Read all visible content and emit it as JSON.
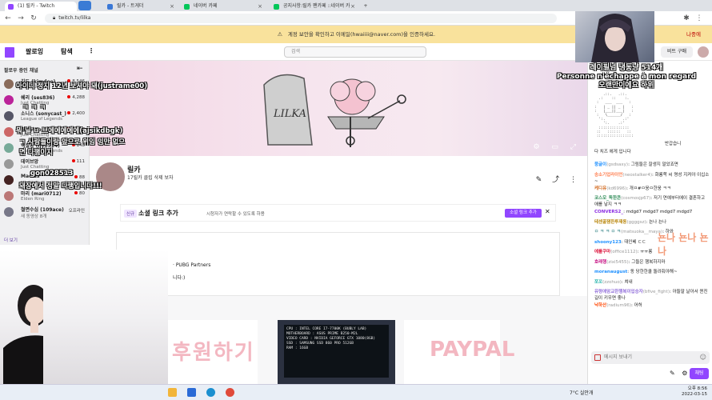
{
  "browser": {
    "tabs": [
      {
        "label": "(1) 릴카 - Twitch",
        "active": true
      },
      {
        "label": "릴카 - 트게더",
        "active": false
      },
      {
        "label": "네이버 카페",
        "active": false
      },
      {
        "label": "공지사항:릴카 팬카페 ::네이버 카",
        "active": false
      }
    ],
    "new_tab": "+",
    "url": "twitch.tv/lilka"
  },
  "banner": {
    "text": "계정 보안을 확인하고 이메일(hwaiiii@naver.com)을 인증하세요.",
    "link": "나중에"
  },
  "topnav": {
    "following": "팔로잉",
    "browse": "탐색",
    "more": "⋮",
    "search_placeholder": "검색",
    "bits_button": "비트 구매"
  },
  "sidebar": {
    "title": "팔로우 중인 채널",
    "collapse": "⇤",
    "channels": [
      {
        "name": "김도 (kimdoe)",
        "category": "Days Gone",
        "viewers": "8,546"
      },
      {
        "name": "쉐리 (ses836)",
        "category": "Just Chatting",
        "viewers": "4,288"
      },
      {
        "name": "소니스 (sonycast_)",
        "category": "League of Legends",
        "viewers": "2,400"
      },
      {
        "name": "팔세부 (p.12/45)",
        "category": "Just Chatting",
        "viewers": "1,047"
      },
      {
        "name": "백설양 (ljy0514)",
        "category": "League of Legends",
        "viewers": "148"
      },
      {
        "name": "데이브앙",
        "category": "Just Chatting",
        "viewers": "111"
      },
      {
        "name": "Macius",
        "category": "Lost Ark",
        "viewers": "88"
      },
      {
        "name": "마리 (mari0712)",
        "category": "Elden Ring",
        "viewers": "80"
      },
      {
        "name": "철면수심 (109ace)",
        "category": "새 동영상 8개",
        "viewers": "오프라인"
      }
    ],
    "show_more": "더 보기"
  },
  "stream_overlay_subtitles": [
    {
      "text": "아이디 정지 12년 보셔야 돼(justrame00)"
    },
    {
      "text": "ㅋ ㅋ ㅋ"
    },
    {
      "text": "뭐 닐 ㅂ 브에에에에에(ajsikdbgk)"
    },
    {
      "text": "ㄱ 사람들이랑 앞으로 위임 잉만 없으"
    },
    {
      "text": "면 다행이지"
    },
    {
      "text": "gon028513"
    },
    {
      "text": "돼장에서 정말 다행입니다!!!"
    }
  ],
  "channel": {
    "name": "릴카",
    "description": "17릴카 클립 삭제 보자",
    "icons": "✎ ⤴ ⋮"
  },
  "player": {
    "controls": "⚙ ▭ ⤢"
  },
  "social": {
    "tag": "신규",
    "title": "소셜 링크 추가",
    "subtitle": "시청자가 연락할 수 있도록 하용",
    "button": "소셜 링크 추가",
    "close": "✕"
  },
  "about": {
    "line1": "· PUBG Partners",
    "line2": "니다:)"
  },
  "panels": {
    "donate": "후원하기",
    "pc_specs": [
      "CPU : INTEL CORE I7-7700K (BUBLY LAB)",
      "MOTHERBOARD : ASUS PRIME B250-M2L",
      "VIDEO CARD : NVIDIA GEFORCE GTX 1080(8GB)",
      "SSD : SAMSUNG SSD 860 PRO 512GB",
      "RAM : 16GB"
    ],
    "paypal": "PAYPAL"
  },
  "cam_subtitle": [
    "레이필넘 냉동냥 514개",
    "Personne n'échappe à mon regard",
    "오랜만이에요 하위"
  ],
  "chat": {
    "ascii_art": "    .::.   .::.\n  .:    ::    :.\n :   ___  ___   :\n:   | _ || _ |   :\n:   |___||___|   :\n :   \\______/   :\n  ':.        .:'\n    ':.    .:'\n  ::::::::::::::\n ::   ::::::   ::\n :::::::::::::::::",
    "ascii_caption": "다 치즈 에게 입니다",
    "ascii_tail": "반갑습니",
    "messages": [
      {
        "user": "뭉글이",
        "user_id": "(gsdsaxy)",
        "text": "그림들은 잘생지 말았죠면",
        "color": "#1e90ff"
      },
      {
        "user": "송소기업라이언",
        "user_id": "(neostalker4)",
        "text": "화룡쪽 씨 명성 지켜야 이십소~",
        "color": "#ff7f50"
      },
      {
        "user": "케디유",
        "user_id": "(kd6996)",
        "text": "개ㅁ#ㅁ웅ㅁ한웅 ㅋㅋ",
        "color": "#d2691e"
      },
      {
        "user": "코스모_독한콘",
        "user_id": "(cosmosjp67)",
        "text": "저기 연예부터에이 결혼하고 애를 낳지 ㅋㅋ",
        "color": "#2e8b57"
      },
      {
        "user": "CONVERS2_",
        "user_id": "",
        "text": "mdgd7 mdgd7 mdgd7 mdgd7",
        "color": "#8a2be2"
      },
      {
        "user": "테센꿀잼한투재동",
        "user_id": "(ggggsz)",
        "text": "뇬나 뇬나",
        "color": "#b8860b"
      },
      {
        "user": "ㅁ ㅋ ㅋ ㅁ ㅋ",
        "user_id": "(matsuoka__maya)",
        "text": "하와",
        "color": "#5f9ea0"
      },
      {
        "user": "shoony123",
        "user_id": "",
        "text": "대인베 ㄷㄷ",
        "color": "#1e90ff"
      },
      {
        "user": "에롤쿠마",
        "user_id": "(office1112)",
        "text": "ㅠㅠ롱",
        "color": "#dc143c"
      },
      {
        "user": "호래행",
        "user_id": "(zixi5455)",
        "text": "그들은 행복하지마",
        "color": "#c71585"
      },
      {
        "user": "moranaugust",
        "user_id": "",
        "text": "동 당한한쿨 돌려줘야해~",
        "color": "#1e90ff"
      },
      {
        "user": "쪼꼬",
        "user_id": "(zzohuo)",
        "text": "쳐내",
        "color": "#20b2aa"
      },
      {
        "user": "유령애암교한행복이입승자",
        "user_id": "(bfive_fight)",
        "text": "아들말 날아서 퀸진길이 키우면 좋나",
        "color": "#9370db"
      },
      {
        "user": "낙하산",
        "user_id": "(radium96)",
        "text": "어허",
        "color": "#ff4500"
      }
    ],
    "input_placeholder": "메시지 보내기",
    "send": "채팅"
  },
  "big_overlay": "뇬나 뇬나 뇬나",
  "taskbar": {
    "weather": "7°C 실안개",
    "time": "오후 8:56",
    "date": "2022-03-15"
  },
  "colors": {
    "twitch_purple": "#9146ff",
    "banner_yellow": "#f9e29c"
  }
}
